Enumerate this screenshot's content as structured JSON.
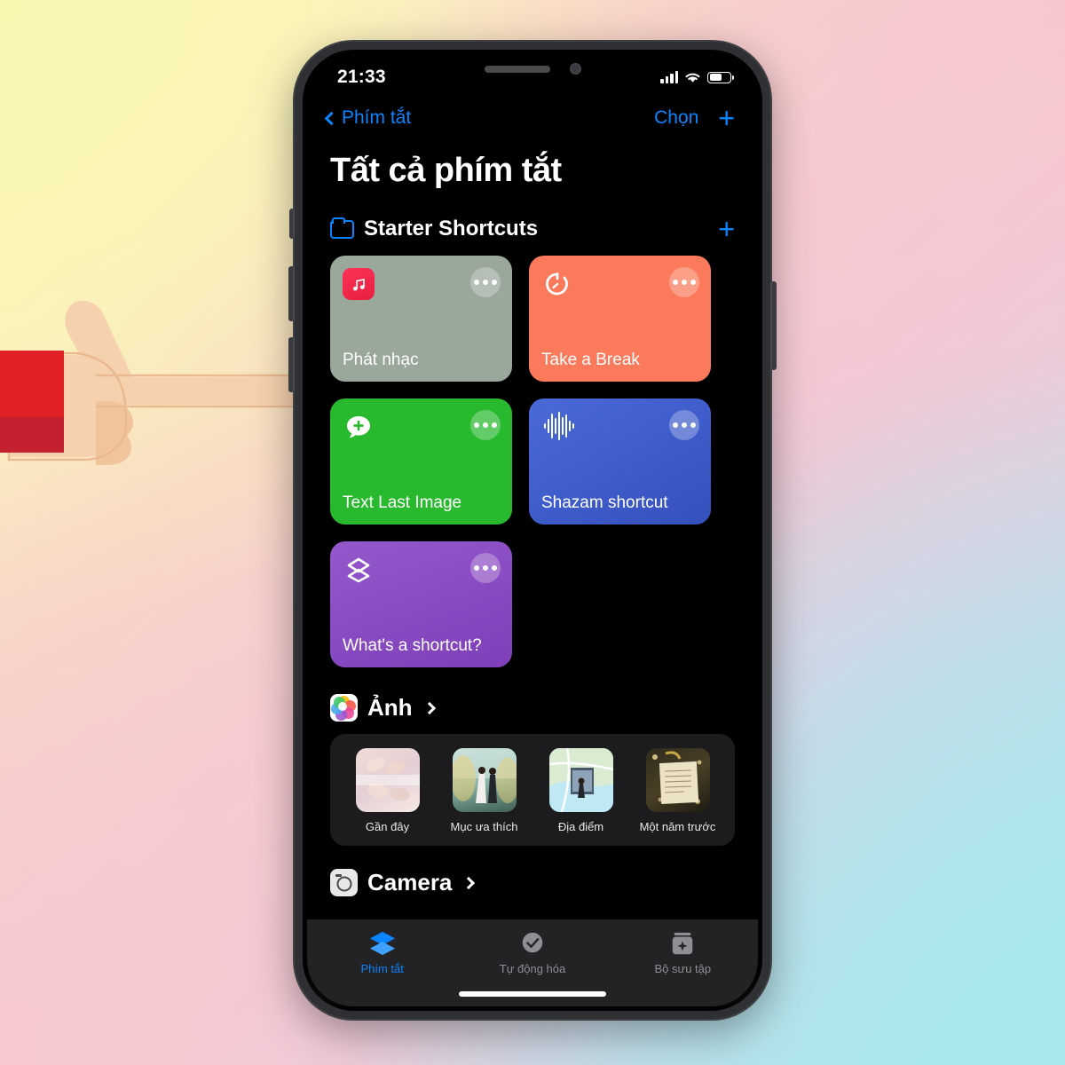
{
  "status_bar": {
    "time": "21:33",
    "signal_icon": "cellular-signal-icon",
    "wifi_icon": "wifi-icon",
    "battery_icon": "battery-icon"
  },
  "nav": {
    "back_label": "Phím tắt",
    "back_icon": "chevron-left-icon",
    "choose_label": "Chọn",
    "add_label": "+"
  },
  "page_title": "Tất cả phím tắt",
  "folder_section": {
    "icon": "folder-icon",
    "title": "Starter Shortcuts",
    "add_label": "+",
    "cards": [
      {
        "name": "Phát nhạc",
        "color": "#9aa79b",
        "icon": "music-note-icon",
        "menu": "ellipsis-icon"
      },
      {
        "name": "Take a Break",
        "color": "#fb7a5c",
        "icon": "timer-icon",
        "menu": "ellipsis-icon"
      },
      {
        "name": "Text Last Image",
        "color": "#28b92e",
        "icon": "message-plus-icon",
        "menu": "ellipsis-icon"
      },
      {
        "name": "Shazam shortcut",
        "color": "#3b5bcc",
        "icon": "waveform-icon",
        "menu": "ellipsis-icon"
      },
      {
        "name": "What's a shortcut?",
        "color": "#8c4dc4",
        "icon": "layers-icon",
        "menu": "ellipsis-icon"
      }
    ]
  },
  "photos_section": {
    "icon": "photos-app-icon",
    "title": "Ảnh",
    "chevron": "chevron-right-icon",
    "items": [
      {
        "label": "Gần đây",
        "thumb": "nails-photo-thumbnail"
      },
      {
        "label": "Mục ưa thích",
        "thumb": "wedding-photo-thumbnail"
      },
      {
        "label": "Địa điểm",
        "thumb": "map-photo-thumbnail"
      },
      {
        "label": "Một năm trước",
        "thumb": "note-photo-thumbnail"
      }
    ]
  },
  "camera_section": {
    "icon": "camera-app-icon",
    "title": "Camera",
    "chevron": "chevron-right-icon"
  },
  "tab_bar": {
    "tabs": [
      {
        "label": "Phím tắt",
        "icon": "shortcuts-icon",
        "active": true
      },
      {
        "label": "Tự động hóa",
        "icon": "clock-check-icon",
        "active": false
      },
      {
        "label": "Bộ sưu tập",
        "icon": "gallery-icon",
        "active": false
      }
    ]
  },
  "cursor": {
    "type": "pointing-hand-cursor",
    "skin_color": "#f6d1ae",
    "sleeve_color": "#e01f26"
  },
  "theme": {
    "accent": "#0a84ff",
    "screen_bg": "#000000",
    "tab_inactive": "#8e8e93"
  }
}
